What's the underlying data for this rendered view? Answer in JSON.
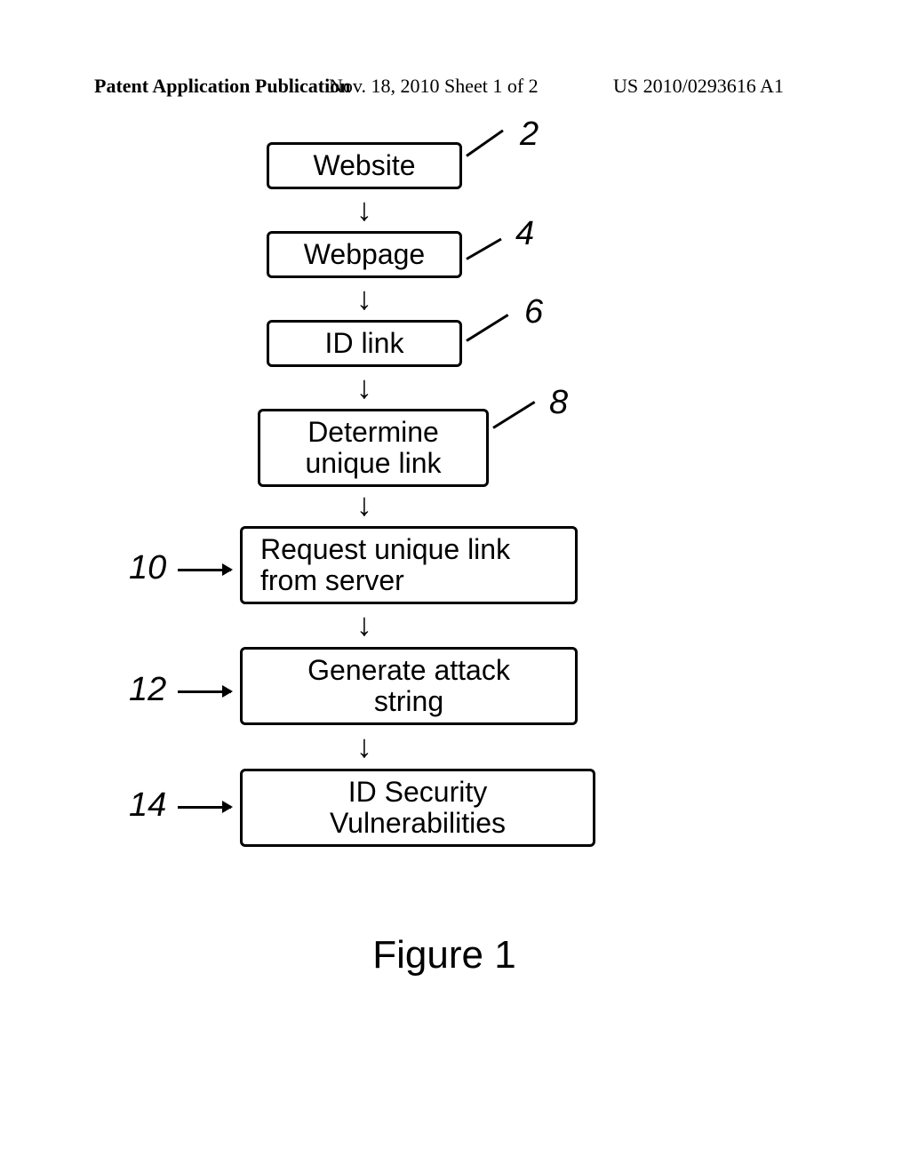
{
  "header": {
    "left": "Patent Application Publication",
    "center": "Nov. 18, 2010  Sheet 1 of 2",
    "right": "US 2010/0293616 A1"
  },
  "boxes": {
    "b2": {
      "text": [
        "Website"
      ],
      "ref": "2"
    },
    "b4": {
      "text": [
        "Webpage"
      ],
      "ref": "4"
    },
    "b6": {
      "text": [
        "ID link"
      ],
      "ref": "6"
    },
    "b8": {
      "text": [
        "Determine",
        "unique link"
      ],
      "ref": "8"
    },
    "b10": {
      "text": [
        "Request unique link",
        "from server"
      ],
      "ref": "10"
    },
    "b12": {
      "text": [
        "Generate attack",
        "string"
      ],
      "ref": "12"
    },
    "b14": {
      "text": [
        "ID Security",
        "Vulnerabilities"
      ],
      "ref": "14"
    }
  },
  "caption": "Figure 1"
}
